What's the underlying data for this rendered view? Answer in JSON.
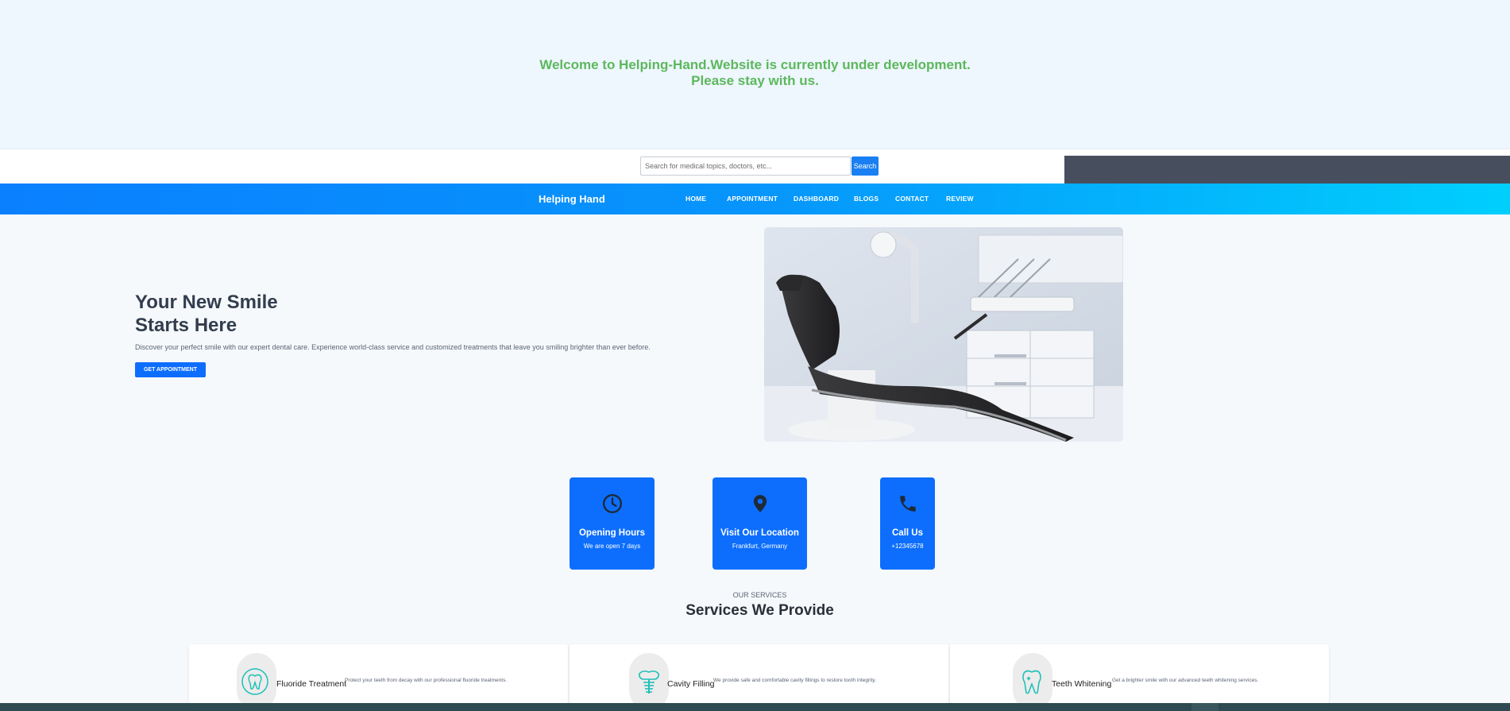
{
  "banner": {
    "line1": "Welcome to Helping-Hand.Website is currently under development.",
    "line2": "Please stay with us."
  },
  "search": {
    "placeholder": "Search for medical topics, doctors, etc...",
    "button_label": "Search"
  },
  "nav": {
    "brand": "Helping Hand",
    "items": [
      "HOME",
      "APPOINTMENT",
      "DASHBOARD",
      "BLOGS",
      "CONTACT",
      "REVIEW"
    ]
  },
  "hero": {
    "title_line1": "Your New Smile",
    "title_line2": "Starts Here",
    "description": "Discover your perfect smile with our expert dental care. Experience world-class service and customized treatments that leave you smiling brighter than ever before.",
    "button_label": "GET APPOINTMENT"
  },
  "info_cards": [
    {
      "icon": "clock-icon",
      "title": "Opening Hours",
      "subtitle": "We are open 7 days"
    },
    {
      "icon": "location-pin-icon",
      "title": "Visit Our Location",
      "subtitle": "Frankfurt, Germany"
    },
    {
      "icon": "phone-icon",
      "title": "Call Us",
      "subtitle": "+12345678"
    }
  ],
  "services": {
    "eyebrow": "OUR SERVICES",
    "title": "Services We Provide",
    "items": [
      {
        "icon": "tooth-refresh-icon",
        "name": "Fluoride Treatment",
        "description": "Protect your teeth from decay with our professional fluoride treatments."
      },
      {
        "icon": "tooth-implant-icon",
        "name": "Cavity Filling",
        "description": "We provide safe and comfortable cavity fillings to restore tooth integrity."
      },
      {
        "icon": "tooth-sparkle-icon",
        "name": "Teeth Whitening",
        "description": "Get a brighter smile with our advanced teeth whitening services."
      }
    ]
  },
  "colors": {
    "primary": "#0d6efd",
    "banner_text": "#5cb85c",
    "nav_gradient_start": "#0a80ff",
    "nav_gradient_end": "#00cffd",
    "service_icon": "#20c0b8"
  }
}
